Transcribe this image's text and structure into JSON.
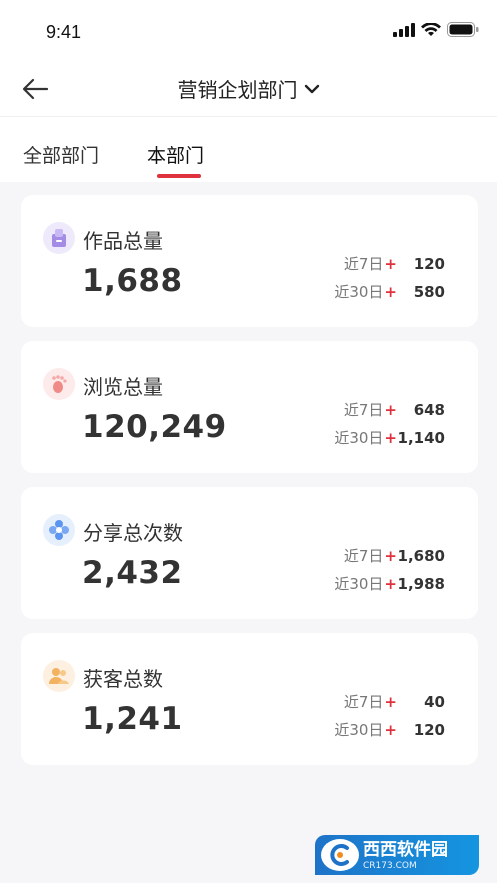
{
  "status_bar": {
    "time": "9:41"
  },
  "nav": {
    "title": "营销企划部门"
  },
  "tabs": [
    {
      "label": "全部部门",
      "active": false
    },
    {
      "label": "本部门",
      "active": true
    }
  ],
  "accent": "#e0323d",
  "cards": [
    {
      "icon": "works-icon",
      "title": "作品总量",
      "total": "1,688",
      "stats": [
        {
          "label": "近7日",
          "plus": "+",
          "value": "120"
        },
        {
          "label": "近30日",
          "plus": "+",
          "value": "580"
        }
      ]
    },
    {
      "icon": "footprint-icon",
      "title": "浏览总量",
      "total": "120,249",
      "stats": [
        {
          "label": "近7日",
          "plus": "+",
          "value": "648"
        },
        {
          "label": "近30日",
          "plus": "+",
          "value": "1,140"
        }
      ]
    },
    {
      "icon": "share-icon",
      "title": "分享总次数",
      "total": "2,432",
      "stats": [
        {
          "label": "近7日",
          "plus": "+",
          "value": "1,680"
        },
        {
          "label": "近30日",
          "plus": "+",
          "value": "1,988"
        }
      ]
    },
    {
      "icon": "customers-icon",
      "title": "获客总数",
      "total": "1,241",
      "stats": [
        {
          "label": "近7日",
          "plus": "+",
          "value": "40"
        },
        {
          "label": "近30日",
          "plus": "+",
          "value": "120"
        }
      ]
    }
  ],
  "watermark": {
    "text": "西西软件园",
    "sub": "CR173.COM"
  }
}
